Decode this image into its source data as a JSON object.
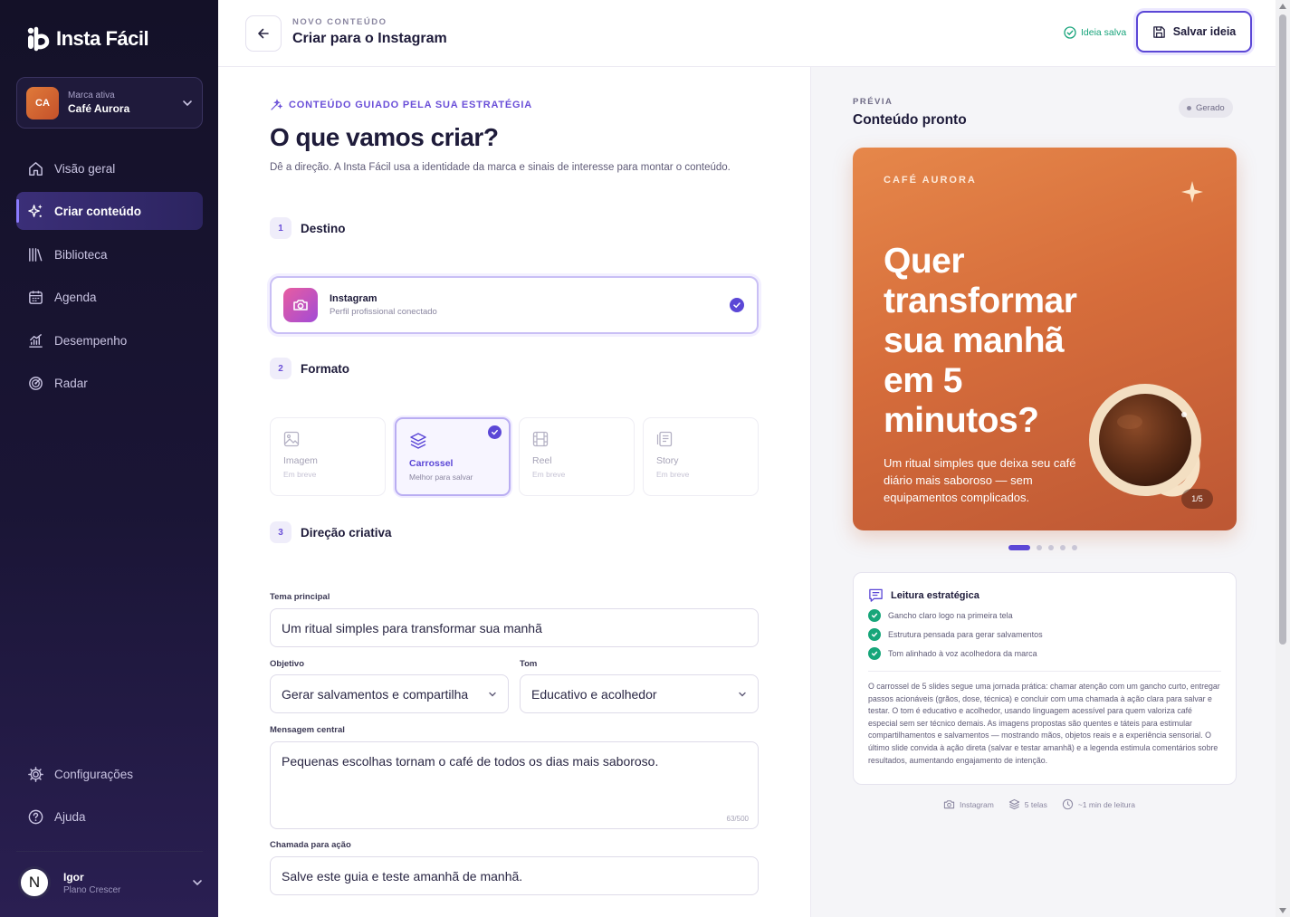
{
  "app": {
    "name": "Insta Fácil"
  },
  "sidebar": {
    "brand": {
      "initials": "CA",
      "label": "Marca ativa",
      "name": "Café Aurora"
    },
    "items": [
      {
        "label": "Visão geral",
        "icon": "home-icon"
      },
      {
        "label": "Criar conteúdo",
        "icon": "sparkles-icon",
        "active": true
      },
      {
        "label": "Biblioteca",
        "icon": "library-icon"
      },
      {
        "label": "Agenda",
        "icon": "calendar-icon"
      },
      {
        "label": "Desempenho",
        "icon": "chart-icon"
      },
      {
        "label": "Radar",
        "icon": "radar-icon"
      }
    ],
    "bottom_items": [
      {
        "label": "Configurações",
        "icon": "gear-icon"
      },
      {
        "label": "Ajuda",
        "icon": "help-icon"
      }
    ],
    "user": {
      "initial": "N",
      "name": "Igor",
      "plan": "Plano Crescer"
    }
  },
  "header": {
    "kicker": "NOVO CONTEÚDO",
    "title": "Criar para o Instagram",
    "saved_status": "Ideia salva",
    "save_label": "Salvar ideia"
  },
  "form": {
    "kicker": "CONTEÚDO GUIADO PELA SUA ESTRATÉGIA",
    "title": "O que vamos criar?",
    "intro": "Dê a direção. A Insta Fácil usa a identidade da marca e sinais de interesse para montar o conteúdo.",
    "steps": [
      {
        "num": "1",
        "label": "Destino"
      },
      {
        "num": "2",
        "label": "Formato"
      },
      {
        "num": "3",
        "label": "Direção criativa"
      }
    ],
    "destination": {
      "name": "Instagram",
      "sub": "Perfil profissional conectado"
    },
    "formats": [
      {
        "name": "Imagem",
        "sub": "Em breve",
        "icon": "image-icon"
      },
      {
        "name": "Carrossel",
        "sub": "Melhor para salvar",
        "icon": "layers-icon",
        "selected": true
      },
      {
        "name": "Reel",
        "sub": "Em breve",
        "icon": "film-icon"
      },
      {
        "name": "Story",
        "sub": "Em breve",
        "icon": "story-icon"
      }
    ],
    "fields": {
      "theme_label": "Tema principal",
      "theme_value": "Um ritual simples para transformar sua manhã",
      "objective_label": "Objetivo",
      "objective_value": "Gerar salvamentos e compartilha",
      "tone_label": "Tom",
      "tone_value": "Educativo e acolhedor",
      "message_label": "Mensagem central",
      "message_value": "Pequenas escolhas tornam o café de todos os dias mais saboroso.",
      "message_counter": "63/500",
      "cta_label": "Chamada para ação",
      "cta_value": "Salve este guia e teste amanhã de manhã."
    }
  },
  "preview": {
    "kicker": "PRÉVIA",
    "title": "Conteúdo pronto",
    "badge": "Gerado",
    "slide": {
      "brand": "CAFÉ AURORA",
      "title": "Quer transformar sua manhã em 5 minutos?",
      "body": "Um ritual simples que deixa seu café diário mais saboroso — sem equipamentos complicados.",
      "page": "1/5",
      "total_dots": 5,
      "active_dot": 1
    },
    "insight": {
      "title": "Leitura estratégica",
      "checks": [
        "Gancho claro logo na primeira tela",
        "Estrutura pensada para gerar salvamentos",
        "Tom alinhado à voz acolhedora da marca"
      ],
      "paragraph": "O carrossel de 5 slides segue uma jornada prática: chamar atenção com um gancho curto, entregar passos acionáveis (grãos, dose, técnica) e concluir com uma chamada à ação clara para salvar e testar. O tom é educativo e acolhedor, usando linguagem acessível para quem valoriza café especial sem ser técnico demais. As imagens propostas são quentes e táteis para estimular compartilhamentos e salvamentos — mostrando mãos, objetos reais e a experiência sensorial. O último slide convida à ação direta (salvar e testar amanhã) e a legenda estimula comentários sobre resultados, aumentando engajamento de intenção."
    },
    "meta": {
      "platform": "Instagram",
      "screens": "5 telas",
      "reading": "~1 min de leitura"
    }
  },
  "colors": {
    "accent": "#5b47d6",
    "sidebar": "#141128",
    "success": "#17a67a",
    "slide": "#d66d3b"
  }
}
